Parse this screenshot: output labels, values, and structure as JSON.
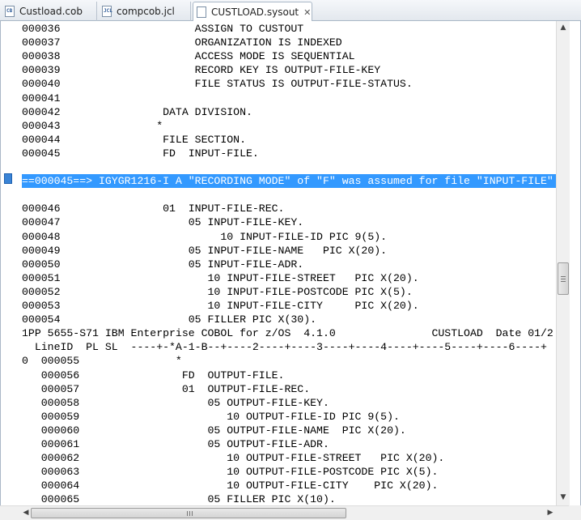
{
  "tabs": [
    {
      "label": "Custload.cob",
      "icon": "cobol-file-icon",
      "icon_text": "CB",
      "active": false
    },
    {
      "label": "compcob.jcl",
      "icon": "jcl-file-icon",
      "icon_text": "JCL",
      "active": false
    },
    {
      "label": "CUSTLOAD.sysout",
      "icon": "text-file-icon",
      "icon_text": "",
      "active": true,
      "close": "✕"
    }
  ],
  "editor": {
    "lines": [
      "000036                     ASSIGN TO CUSTOUT",
      "000037                     ORGANIZATION IS INDEXED",
      "000038                     ACCESS MODE IS SEQUENTIAL",
      "000039                     RECORD KEY IS OUTPUT-FILE-KEY",
      "000040                     FILE STATUS IS OUTPUT-FILE-STATUS.",
      "000041",
      "000042                DATA DIVISION.",
      "000043               *",
      "000044                FILE SECTION.",
      "000045                FD  INPUT-FILE.",
      "",
      "==000045==> IGYGR1216-I A \"RECORDING MODE\" of \"F\" was assumed for file \"INPUT-FILE\"",
      "",
      "000046                01  INPUT-FILE-REC.",
      "000047                    05 INPUT-FILE-KEY.",
      "000048                         10 INPUT-FILE-ID PIC 9(5).",
      "000049                    05 INPUT-FILE-NAME   PIC X(20).",
      "000050                    05 INPUT-FILE-ADR.",
      "000051                       10 INPUT-FILE-STREET   PIC X(20).",
      "000052                       10 INPUT-FILE-POSTCODE PIC X(5).",
      "000053                       10 INPUT-FILE-CITY     PIC X(20).",
      "000054                    05 FILLER PIC X(30).",
      "1PP 5655-S71 IBM Enterprise COBOL for z/OS  4.1.0               CUSTLOAD  Date 01/2",
      "  LineID  PL SL  ----+-*A-1-B--+----2----+----3----+----4----+----5----+----6----+",
      "0  000055               *",
      "   000056                FD  OUTPUT-FILE.",
      "   000057                01  OUTPUT-FILE-REC.",
      "   000058                    05 OUTPUT-FILE-KEY.",
      "   000059                       10 OUTPUT-FILE-ID PIC 9(5).",
      "   000060                    05 OUTPUT-FILE-NAME  PIC X(20).",
      "   000061                    05 OUTPUT-FILE-ADR.",
      "   000062                       10 OUTPUT-FILE-STREET   PIC X(20).",
      "   000063                       10 OUTPUT-FILE-POSTCODE PIC X(5).",
      "   000064                       10 OUTPUT-FILE-CITY    PIC X(20).",
      "   000065                    05 FILLER PIC X(10)."
    ],
    "selected_line_index": 11,
    "annotation_marker": "info-marker-icon"
  },
  "scrollbars": {
    "up": "▲",
    "down": "▼",
    "left": "◀",
    "right": "▶"
  }
}
